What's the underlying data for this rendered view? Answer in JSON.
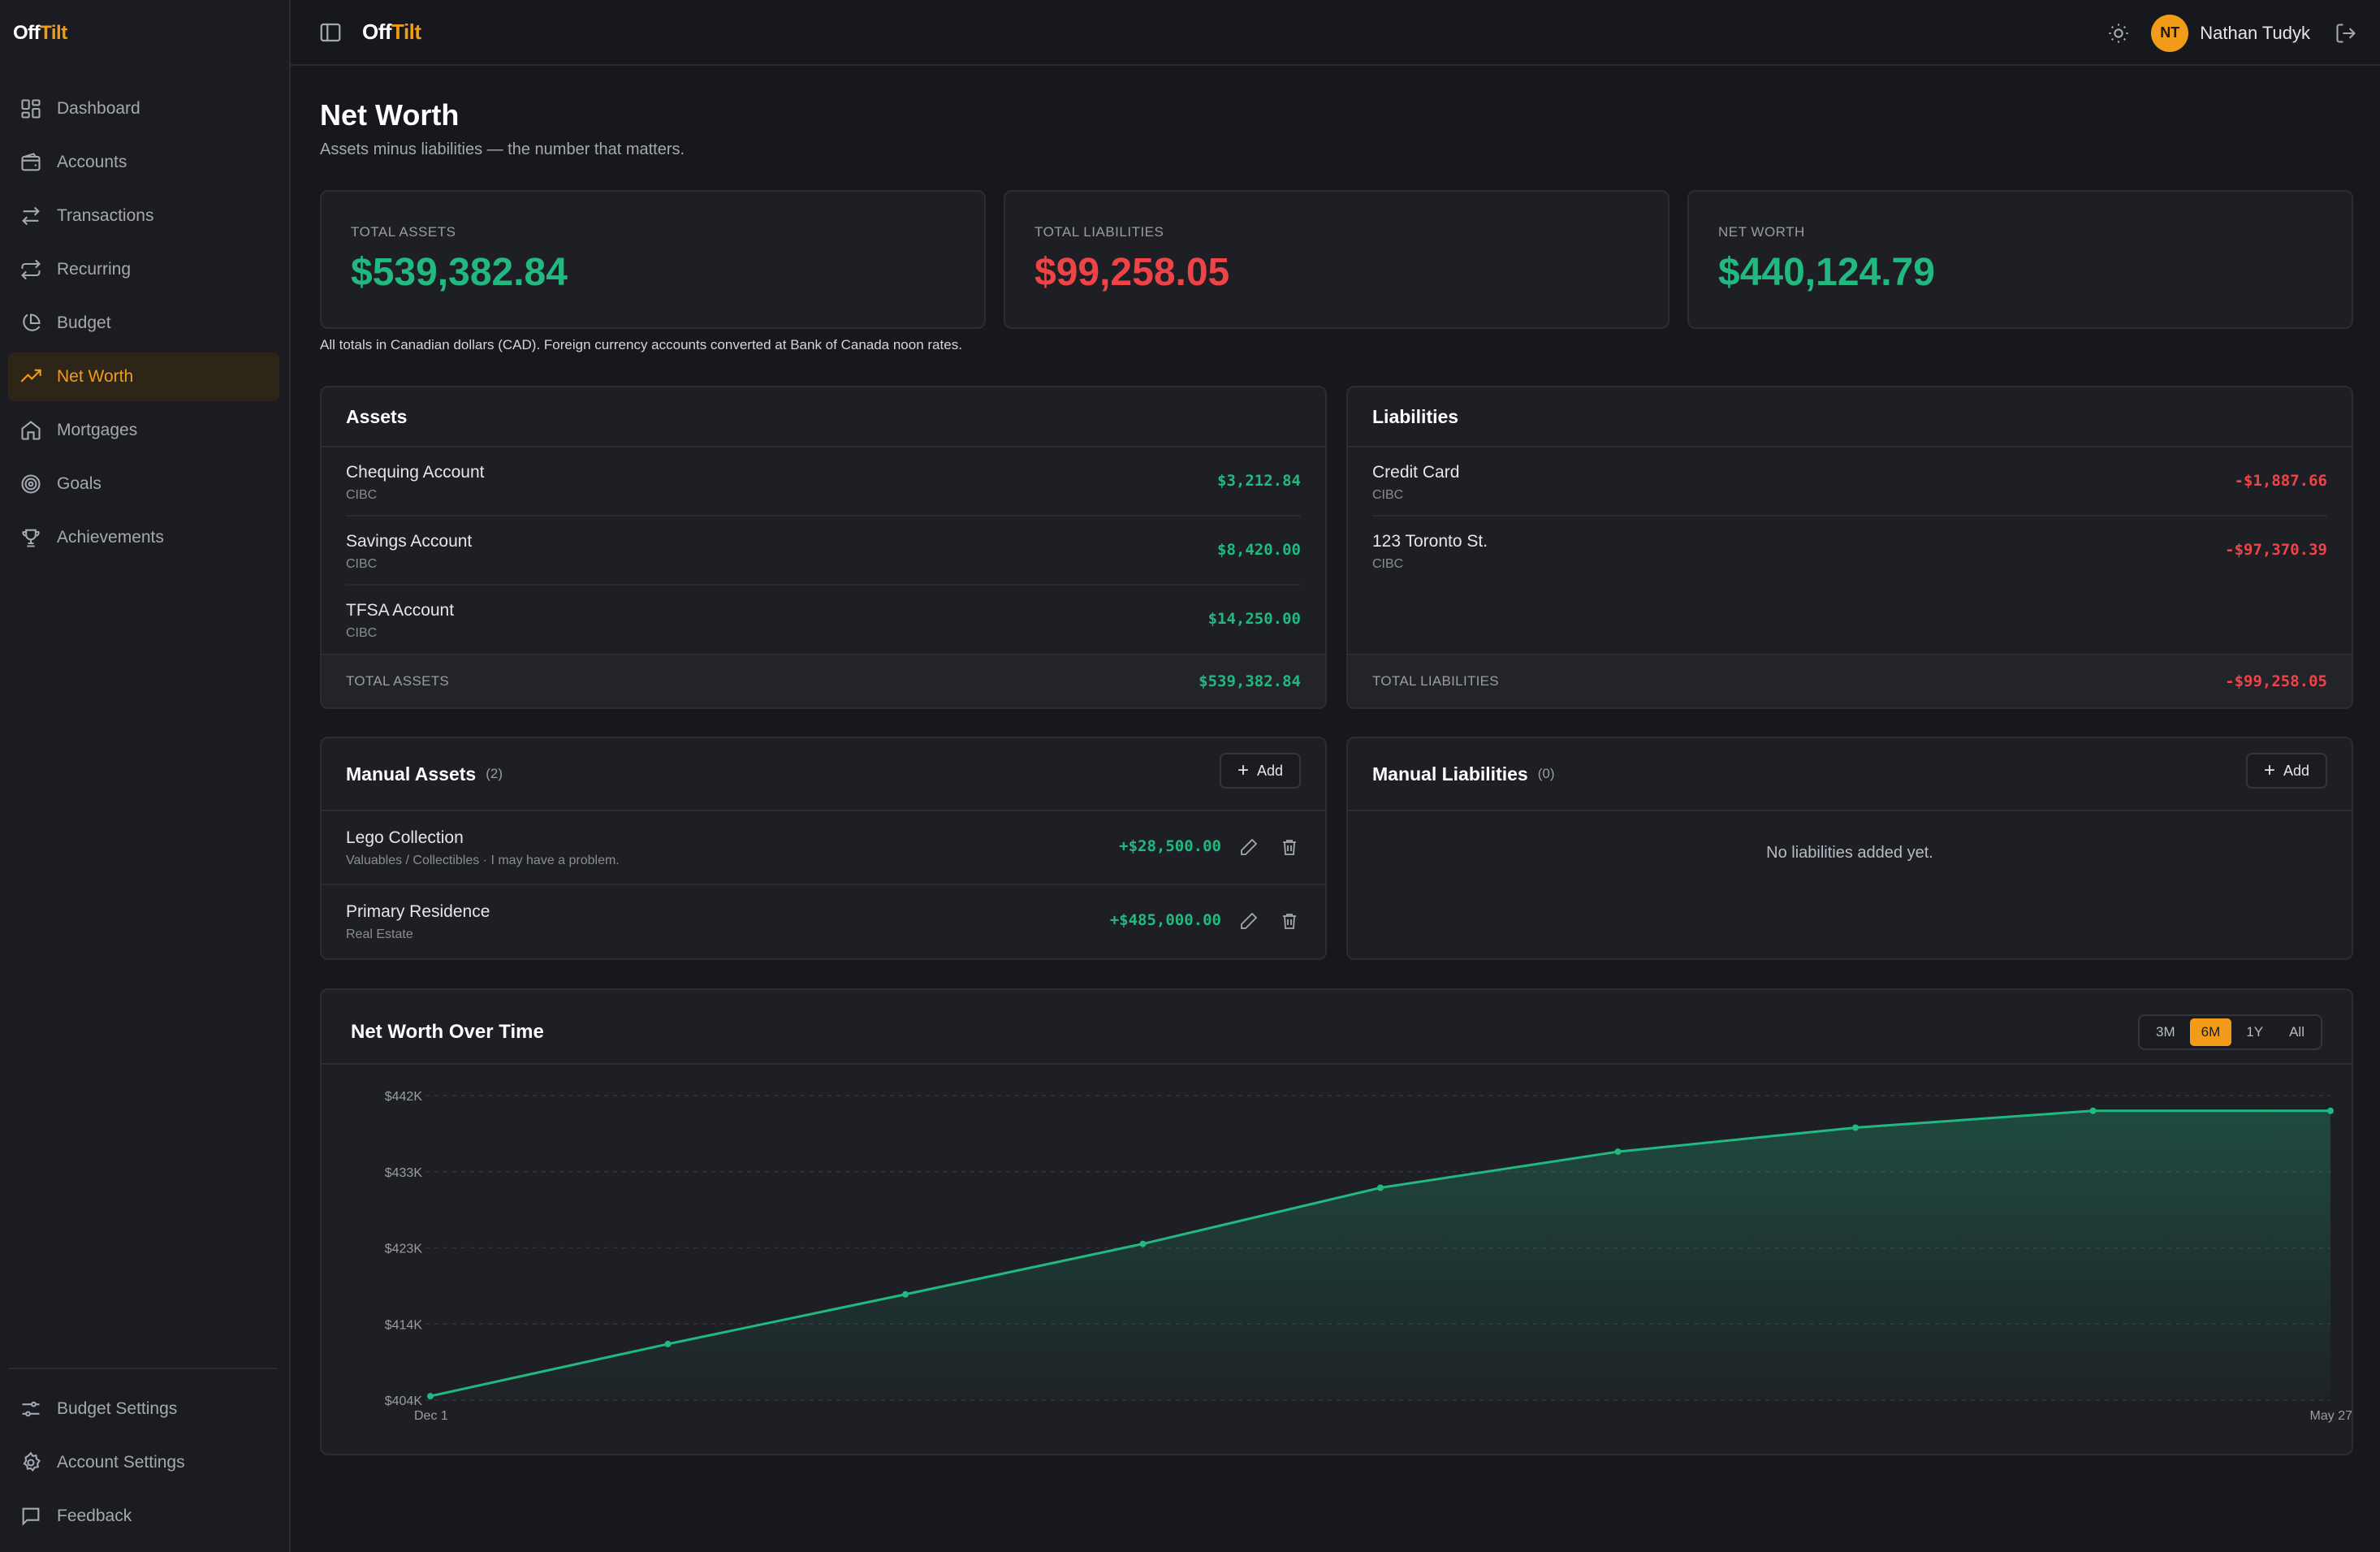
{
  "app": {
    "logo_a": "Off",
    "logo_b": "Tilt"
  },
  "sidebar": {
    "items": [
      {
        "label": "Dashboard",
        "icon": "grid-icon"
      },
      {
        "label": "Accounts",
        "icon": "wallet-icon"
      },
      {
        "label": "Transactions",
        "icon": "arrows-icon"
      },
      {
        "label": "Recurring",
        "icon": "repeat-icon"
      },
      {
        "label": "Budget",
        "icon": "pie-icon"
      },
      {
        "label": "Net Worth",
        "icon": "trend-icon",
        "active": true
      },
      {
        "label": "Mortgages",
        "icon": "home-icon"
      },
      {
        "label": "Goals",
        "icon": "target-icon"
      },
      {
        "label": "Achievements",
        "icon": "trophy-icon"
      }
    ],
    "bottom": [
      {
        "label": "Budget Settings",
        "icon": "sliders-icon"
      },
      {
        "label": "Account Settings",
        "icon": "gear-icon"
      },
      {
        "label": "Feedback",
        "icon": "message-icon"
      }
    ]
  },
  "topbar": {
    "brand_a": "Off",
    "brand_b": "Tilt",
    "avatar_initials": "NT",
    "user_name": "Nathan Tudyk"
  },
  "page": {
    "title": "Net Worth",
    "subtitle": "Assets minus liabilities — the number that matters.",
    "note": "All totals in Canadian dollars (CAD). Foreign currency accounts converted at Bank of Canada noon rates."
  },
  "stats": {
    "assets_label": "TOTAL ASSETS",
    "assets_value": "$539,382.84",
    "liabilities_label": "TOTAL LIABILITIES",
    "liabilities_value": "$99,258.05",
    "networth_label": "NET WORTH",
    "networth_value": "$440,124.79"
  },
  "assets": {
    "title": "Assets",
    "rows": [
      {
        "name": "Chequing Account",
        "sub": "CIBC",
        "amount": "$3,212.84"
      },
      {
        "name": "Savings Account",
        "sub": "CIBC",
        "amount": "$8,420.00"
      },
      {
        "name": "TFSA Account",
        "sub": "CIBC",
        "amount": "$14,250.00"
      }
    ],
    "total_label": "TOTAL ASSETS",
    "total_value": "$539,382.84"
  },
  "liabilities": {
    "title": "Liabilities",
    "rows": [
      {
        "name": "Credit Card",
        "sub": "CIBC",
        "amount": "-$1,887.66"
      },
      {
        "name": "123 Toronto St.",
        "sub": "CIBC",
        "amount": "-$97,370.39"
      }
    ],
    "total_label": "TOTAL LIABILITIES",
    "total_value": "-$99,258.05"
  },
  "manual_assets": {
    "title": "Manual Assets",
    "count": "(2)",
    "add_label": "Add",
    "rows": [
      {
        "name": "Lego Collection",
        "sub": "Valuables / Collectibles · I may have a problem.",
        "amount": "+$28,500.00"
      },
      {
        "name": "Primary Residence",
        "sub": "Real Estate",
        "amount": "+$485,000.00"
      }
    ]
  },
  "manual_liabilities": {
    "title": "Manual Liabilities",
    "count": "(0)",
    "add_label": "Add",
    "empty": "No liabilities added yet."
  },
  "chart_section": {
    "title": "Net Worth Over Time",
    "ranges": [
      "3M",
      "6M",
      "1Y",
      "All"
    ],
    "active_range": "6M"
  },
  "chart_data": {
    "type": "area",
    "x_start_label": "Dec 1",
    "x_end_label": "May 27",
    "y_ticks": [
      "$442K",
      "$433K",
      "$423K",
      "$414K",
      "$404K"
    ],
    "ylim": [
      404000,
      442000
    ],
    "grid": true,
    "color": "#22b981",
    "series": [
      {
        "values": [
          404500,
          411000,
          417200,
          423500,
          430500,
          435000,
          438000,
          440100,
          440100
        ]
      }
    ]
  }
}
